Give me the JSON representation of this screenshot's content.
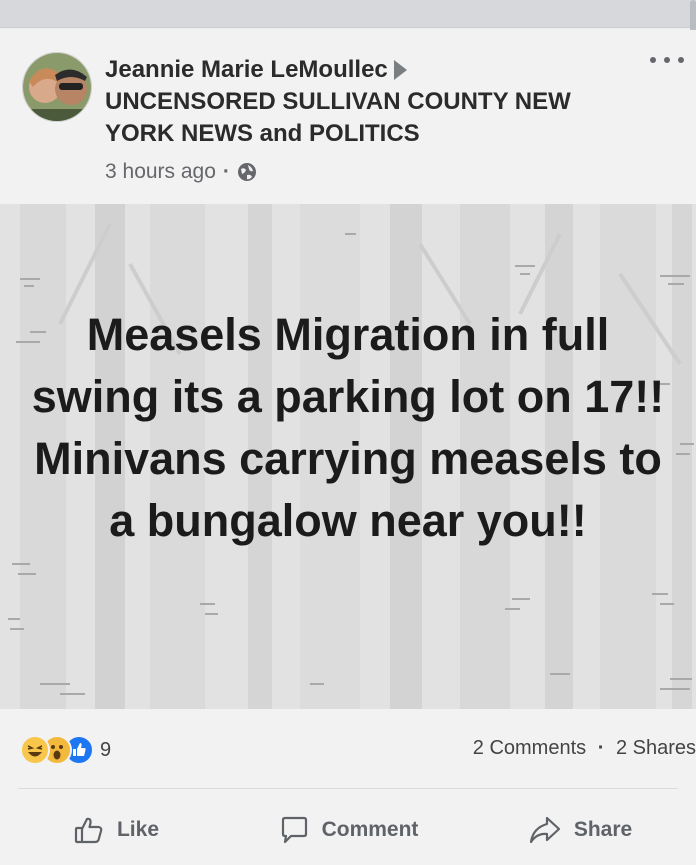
{
  "post": {
    "author": "Jeannie Marie LeMoullec",
    "group": "UNCENSORED SULLIVAN COUNTY NEW YORK NEWS and POLITICS",
    "time": "3 hours ago",
    "separator": "·",
    "image_text": "Measels Migration in full swing its a parking lot on 17!! Minivans carrying measels to a bungalow near you!!"
  },
  "reactions": {
    "icons": [
      "haha-icon",
      "wow-icon",
      "like-icon"
    ],
    "count": "9",
    "comments": "2 Comments",
    "shares": "2 Shares",
    "separator": "·"
  },
  "actions": {
    "like": "Like",
    "comment": "Comment",
    "share": "Share"
  },
  "colors": {
    "like_blue": "#1d76f2",
    "reaction_yellow": "#f7c64a",
    "text_gray": "#65676b",
    "card_bg": "#f2f2f2"
  }
}
